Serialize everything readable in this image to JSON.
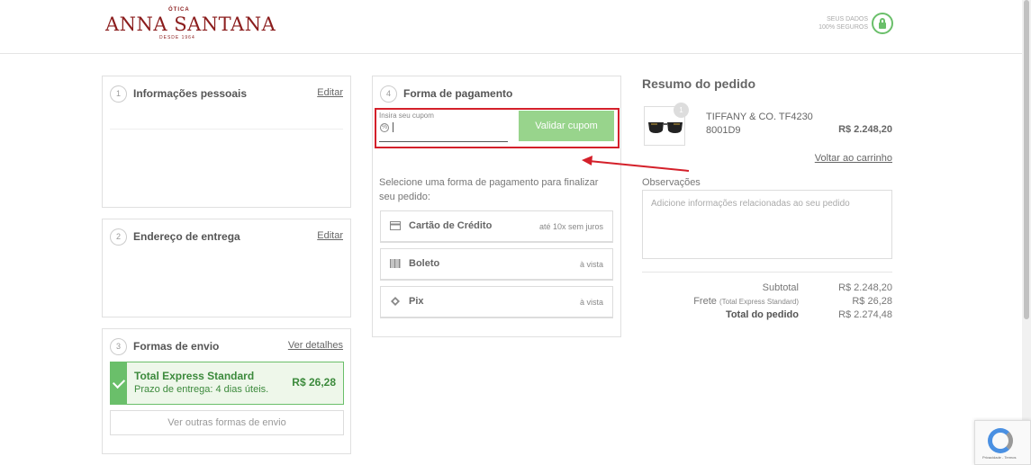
{
  "brand": {
    "top": "ÓTICA",
    "name": "ANNA SANTANA",
    "since": "DESDE 1964",
    "color": "#8b1d1d"
  },
  "secure": {
    "line1": "SEUS DADOS",
    "line2": "100% SEGUROS",
    "icon": "lock-icon"
  },
  "personal": {
    "step": "1",
    "title": "Informações pessoais",
    "edit": "Editar"
  },
  "address": {
    "step": "2",
    "title": "Endereço de entrega",
    "edit": "Editar"
  },
  "shipping": {
    "step": "3",
    "title": "Formas de envio",
    "details": "Ver detalhes",
    "selected": {
      "name": "Total Express Standard",
      "eta": "Prazo de entrega: 4 dias úteis.",
      "price": "R$ 26,28"
    },
    "other": "Ver outras formas de envio"
  },
  "payment": {
    "step": "4",
    "title": "Forma de pagamento",
    "coupon_label": "Insira seu cupom",
    "coupon_button": "Validar cupom",
    "instruction": "Selecione uma forma de pagamento para finalizar seu pedido:",
    "options": [
      {
        "name": "Cartão de Crédito",
        "note": "até 10x sem juros",
        "icon": "credit-card-icon"
      },
      {
        "name": "Boleto",
        "note": "à vista",
        "icon": "barcode-icon"
      },
      {
        "name": "Pix",
        "note": "à vista",
        "icon": "pix-icon"
      }
    ]
  },
  "summary": {
    "title": "Resumo do pedido",
    "product": {
      "qty": "1",
      "name_line1": "TIFFANY & CO. TF4230",
      "name_line2": "8001D9",
      "price": "R$ 2.248,20"
    },
    "back_link": "Voltar ao carrinho",
    "notes_label": "Observações",
    "notes_placeholder": "Adicione informações relacionadas ao seu pedido",
    "subtotal_label": "Subtotal",
    "subtotal_value": "R$ 2.248,20",
    "shipping_label": "Frete",
    "shipping_sub": "(Total Express Standard)",
    "shipping_value": "R$ 26,28",
    "total_label": "Total do pedido",
    "total_value": "R$ 2.274,48"
  },
  "recaptcha": {
    "text": "Privacidade - Termos"
  },
  "colors": {
    "accent_green": "#6abf6a",
    "button_green": "#98d48c",
    "highlight_red": "#d4202a"
  }
}
